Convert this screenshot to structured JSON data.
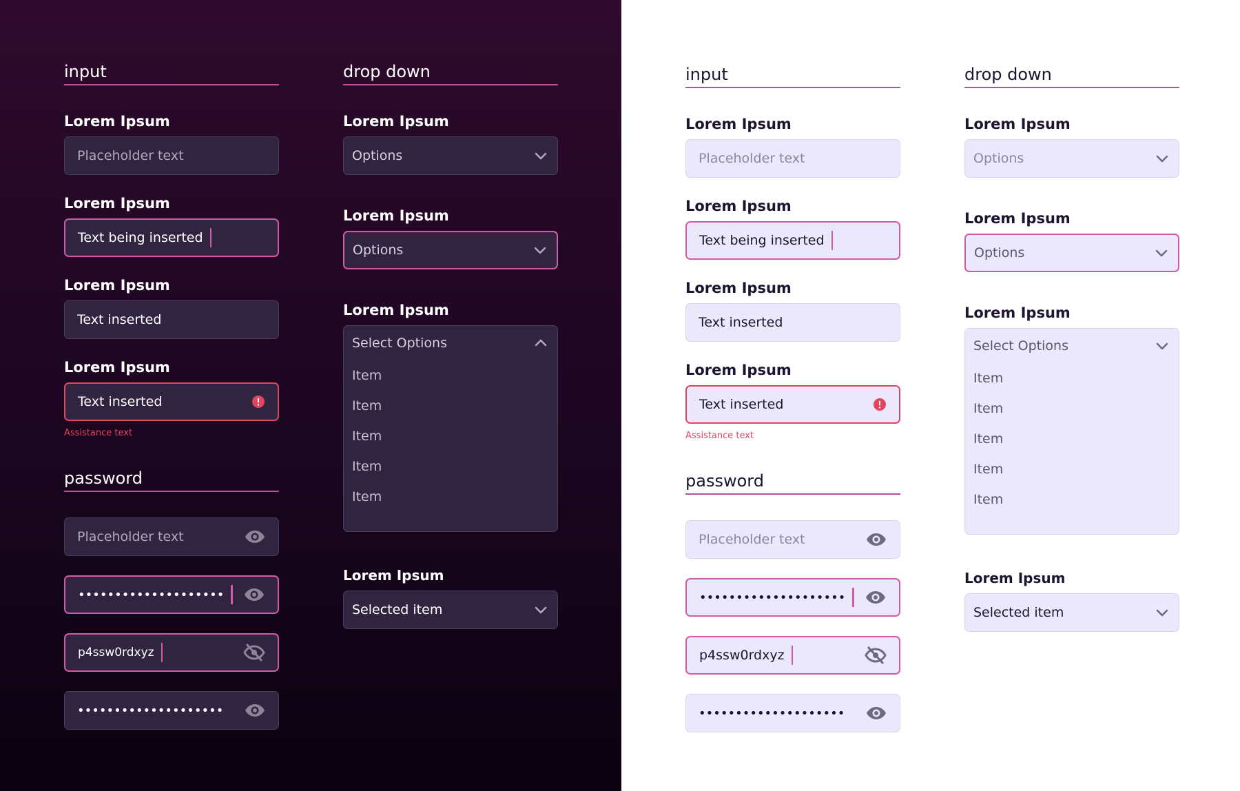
{
  "colors": {
    "accent": "#d25aa8",
    "error": "#e04660",
    "dark_field_bg": "#302440",
    "light_field_bg": "#ebe8fb",
    "dark_panel_top": "#2e0a2c",
    "dark_panel_bottom": "#0a0210"
  },
  "icons": {
    "eye": "eye-icon",
    "eye_slash": "eye-slash-icon",
    "error": "error-icon",
    "chevron_down": "chevron-down-icon",
    "chevron_up": "chevron-up-icon"
  },
  "dark": {
    "input": {
      "heading": "input",
      "fields": [
        {
          "label": "Lorem Ipsum",
          "placeholder": "Placeholder text"
        },
        {
          "label": "Lorem Ipsum",
          "value": "Text being inserted"
        },
        {
          "label": "Lorem Ipsum",
          "value": "Text inserted"
        },
        {
          "label": "Lorem Ipsum",
          "value": "Text inserted",
          "assist": "Assistance text"
        }
      ]
    },
    "password": {
      "heading": "password",
      "fields": [
        {
          "placeholder": "Placeholder text"
        },
        {
          "value": "••••••••••••••••••••"
        },
        {
          "value": "p4ssw0rdxyz"
        },
        {
          "value": "••••••••••••••••••••"
        }
      ]
    },
    "dropdown": {
      "heading": "drop down",
      "fields": [
        {
          "label": "Lorem Ipsum",
          "value": "Options"
        },
        {
          "label": "Lorem Ipsum",
          "value": "Options"
        },
        {
          "label": "Lorem Ipsum",
          "value": "Select Options",
          "items": [
            "Item",
            "Item",
            "Item",
            "Item",
            "Item"
          ]
        },
        {
          "label": "Lorem Ipsum",
          "value": "Selected item"
        }
      ]
    }
  },
  "light": {
    "input": {
      "heading": "input",
      "fields": [
        {
          "label": "Lorem Ipsum",
          "placeholder": "Placeholder text"
        },
        {
          "label": "Lorem Ipsum",
          "value": "Text being inserted"
        },
        {
          "label": "Lorem Ipsum",
          "value": "Text inserted"
        },
        {
          "label": "Lorem Ipsum",
          "value": "Text inserted",
          "assist": "Assistance text"
        }
      ]
    },
    "password": {
      "heading": "password",
      "fields": [
        {
          "placeholder": "Placeholder text"
        },
        {
          "value": "••••••••••••••••••••"
        },
        {
          "value": "p4ssw0rdxyz"
        },
        {
          "value": "••••••••••••••••••••"
        }
      ]
    },
    "dropdown": {
      "heading": "drop down",
      "fields": [
        {
          "label": "Lorem Ipsum",
          "value": "Options"
        },
        {
          "label": "Lorem Ipsum",
          "value": "Options"
        },
        {
          "label": "Lorem Ipsum",
          "value": "Select Options",
          "items": [
            "Item",
            "Item",
            "Item",
            "Item",
            "Item"
          ]
        },
        {
          "label": "Lorem Ipsum",
          "value": "Selected item"
        }
      ]
    }
  }
}
